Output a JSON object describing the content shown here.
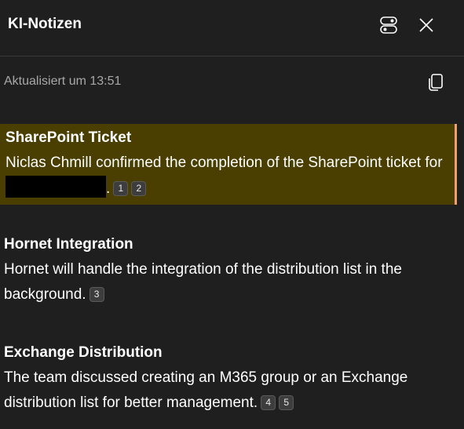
{
  "header": {
    "title": "KI-Notizen",
    "toggle_icon": "view-toggle-icon",
    "close_icon": "close-icon"
  },
  "subheader": {
    "updated": "Aktualisiert um 13:51",
    "copy_icon": "copy-icon"
  },
  "notes": [
    {
      "title": "SharePoint Ticket",
      "body": "Niclas Chmill confirmed the completion of the SharePoint ticket for",
      "body_after": ".",
      "redacted": true,
      "citations": [
        "1",
        "2"
      ],
      "highlighted": true
    },
    {
      "title": "Hornet Integration",
      "body": "Hornet will handle the integration of the distribution list in the background.",
      "citations": [
        "3"
      ],
      "highlighted": false
    },
    {
      "title": "Exchange Distribution",
      "body": "The team discussed creating an M365 group or an Exchange distribution list for better management.",
      "citations": [
        "4",
        "5"
      ],
      "highlighted": false
    }
  ],
  "colors": {
    "background": "#1f1f1f",
    "highlight": "#4a3e00",
    "highlight_border": "#f0a070"
  }
}
